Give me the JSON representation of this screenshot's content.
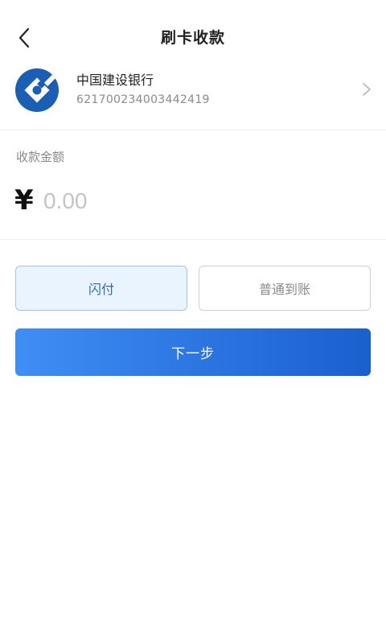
{
  "header": {
    "title": "刷卡收款",
    "back_icon": "chevron-left-icon"
  },
  "bank_card": {
    "bank_name": "中国建设银行",
    "card_number": "621700234003442419",
    "logo_icon": "ccb-bank-logo",
    "chevron_icon": "chevron-right-icon"
  },
  "amount": {
    "label": "收款金额",
    "currency_symbol": "¥",
    "placeholder": "0.00",
    "value": ""
  },
  "payment_options": {
    "flash_label": "闪付",
    "normal_label": "普通到账",
    "selected": "闪付"
  },
  "actions": {
    "next_label": "下一步"
  },
  "colors": {
    "accent": "#2b6cb8",
    "bank_blue": "#1a5fb4",
    "button_gradient_start": "#3f8ef5",
    "button_gradient_end": "#1b5fcf",
    "selected_bg": "#eaf4fe"
  }
}
